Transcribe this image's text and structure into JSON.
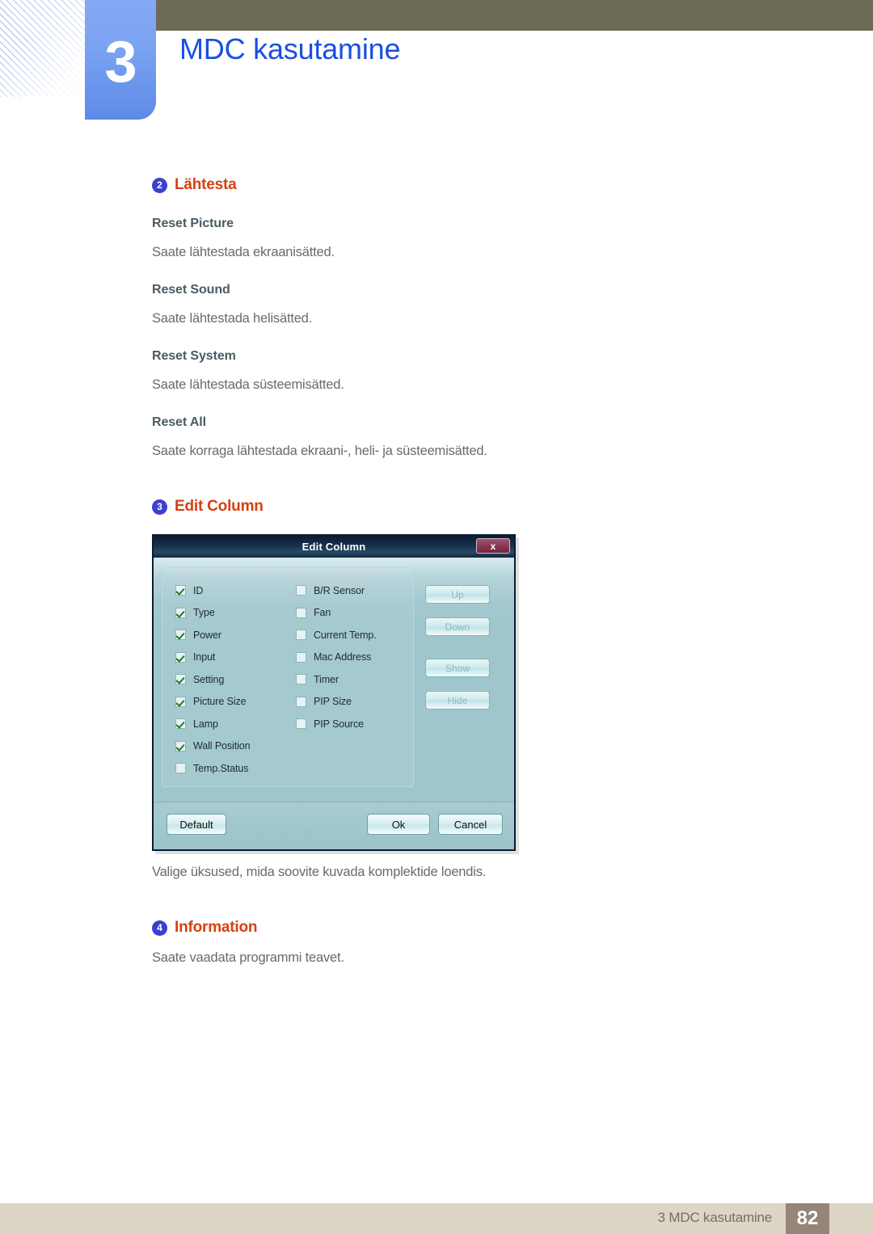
{
  "header": {
    "chapter_number": "3",
    "chapter_title": "MDC kasutamine"
  },
  "sections": {
    "reset": {
      "badge": "2",
      "title": "Lähtesta",
      "items": [
        {
          "head": "Reset Picture",
          "body": "Saate lähtestada ekraanisätted."
        },
        {
          "head": "Reset Sound",
          "body": "Saate lähtestada helisätted."
        },
        {
          "head": "Reset System",
          "body": "Saate lähtestada süsteemisätted."
        },
        {
          "head": "Reset All",
          "body": "Saate korraga lähtestada ekraani-, heli- ja süsteemisätted."
        }
      ]
    },
    "edit_column": {
      "badge": "3",
      "title": "Edit Column",
      "caption": "Valige üksused, mida soovite kuvada komplektide loendis."
    },
    "information": {
      "badge": "4",
      "title": "Information",
      "body": "Saate vaadata programmi teavet."
    }
  },
  "dialog": {
    "title": "Edit Column",
    "close_label": "x",
    "checkboxes_left": [
      {
        "label": "ID",
        "checked": true
      },
      {
        "label": "Type",
        "checked": true
      },
      {
        "label": "Power",
        "checked": true
      },
      {
        "label": "Input",
        "checked": true
      },
      {
        "label": "Setting",
        "checked": true
      },
      {
        "label": "Picture Size",
        "checked": true
      },
      {
        "label": "Lamp",
        "checked": true
      },
      {
        "label": "Wall Position",
        "checked": true
      },
      {
        "label": "Temp.Status",
        "checked": false
      }
    ],
    "checkboxes_right": [
      {
        "label": "B/R Sensor",
        "checked": false
      },
      {
        "label": "Fan",
        "checked": false
      },
      {
        "label": "Current Temp.",
        "checked": false
      },
      {
        "label": "Mac Address",
        "checked": false
      },
      {
        "label": "Timer",
        "checked": false
      },
      {
        "label": "PIP Size",
        "checked": false
      },
      {
        "label": "PIP Source",
        "checked": false
      }
    ],
    "side_buttons": [
      {
        "label": "Up",
        "disabled": true
      },
      {
        "label": "Down",
        "disabled": true
      },
      {
        "label": "Show",
        "disabled": true
      },
      {
        "label": "Hide",
        "disabled": true
      }
    ],
    "footer_buttons": {
      "default": "Default",
      "ok": "Ok",
      "cancel": "Cancel"
    }
  },
  "footer": {
    "text": "3 MDC kasutamine",
    "page": "82"
  },
  "colors": {
    "chapter_title": "#1a4fe0",
    "section_title": "#d5410f",
    "badge": "#3d3fd0",
    "olive_bar": "#6d6b55",
    "footer_bar": "#ddd6c4",
    "footer_page": "#958579",
    "dialog_body": "#9fc6cd",
    "dialog_titlebar": "#16304d",
    "close_button": "#8b3b58",
    "check_mark": "#1f7a1f"
  }
}
